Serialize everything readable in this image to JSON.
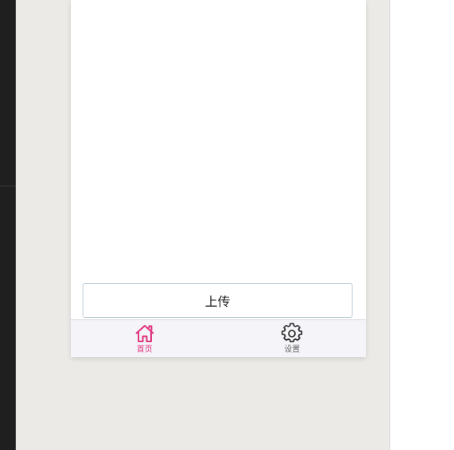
{
  "main": {
    "upload_label": "上传"
  },
  "tabbar": {
    "tabs": [
      {
        "label": "首页",
        "icon": "home-icon",
        "active": true
      },
      {
        "label": "设置",
        "icon": "gear-icon",
        "active": false
      }
    ]
  },
  "colors": {
    "accent": "#e0337d",
    "inactive_icon": "#333333",
    "inactive_label": "#666666"
  }
}
